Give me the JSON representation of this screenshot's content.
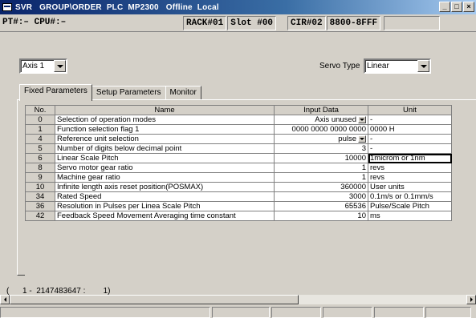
{
  "window": {
    "title": "SVR   GROUP\\ORDER  PLC  MP2300   Offline  Local",
    "minimize_label": "_",
    "maximize_label": "□",
    "close_label": "×"
  },
  "infobar": {
    "pt_cpu": "PT#:– CPU#:–",
    "rack": "RACK#01",
    "slot": "Slot #00",
    "cir": "CIR#02",
    "range": "8800-8FFF"
  },
  "axis_select": {
    "value": "Axis 1"
  },
  "servo_type": {
    "label": "Servo Type",
    "value": "Linear"
  },
  "tabs": [
    {
      "label": "Fixed Parameters",
      "active": true
    },
    {
      "label": "Setup Parameters",
      "active": false
    },
    {
      "label": "Monitor",
      "active": false
    }
  ],
  "grid": {
    "headers": {
      "no": "No.",
      "name": "Name",
      "input": "Input Data",
      "unit": "Unit"
    },
    "rows": [
      {
        "no": "0",
        "name": "Selection of operation modes",
        "input": "Axis unused",
        "unit": "-",
        "dropdown": true
      },
      {
        "no": "1",
        "name": "Function selection flag 1",
        "input": "0000 0000 0000 0000",
        "unit": "0000 H",
        "dropdown": false
      },
      {
        "no": "4",
        "name": "Reference unit selection",
        "input": "pulse",
        "unit": "-",
        "dropdown": true
      },
      {
        "no": "5",
        "name": "Number of digits below decimal point",
        "input": "3",
        "unit": "-",
        "dropdown": false
      },
      {
        "no": "6",
        "name": "Linear Scale Pitch",
        "input": "10000",
        "unit": "1microm or 1nm",
        "dropdown": false,
        "selected": true
      },
      {
        "no": "8",
        "name": "Servo motor gear ratio",
        "input": "1",
        "unit": "revs",
        "dropdown": false
      },
      {
        "no": "9",
        "name": "Machine gear ratio",
        "input": "1",
        "unit": "revs",
        "dropdown": false
      },
      {
        "no": "10",
        "name": "Infinite length axis reset position(POSMAX)",
        "input": "360000",
        "unit": "User units",
        "dropdown": false
      },
      {
        "no": "34",
        "name": "Rated Speed",
        "input": "3000",
        "unit": "0.1m/s or 0.1mm/s",
        "dropdown": false
      },
      {
        "no": "36",
        "name": "Resolution in Pulses per Linea Scale Pitch",
        "input": "65536",
        "unit": "Pulse/Scale Pitch",
        "dropdown": false
      },
      {
        "no": "42",
        "name": "Feedback Speed Movement Averaging time constant",
        "input": "10",
        "unit": "ms",
        "dropdown": false
      }
    ]
  },
  "range_text": "(      1 -  2147483647 :        1)"
}
